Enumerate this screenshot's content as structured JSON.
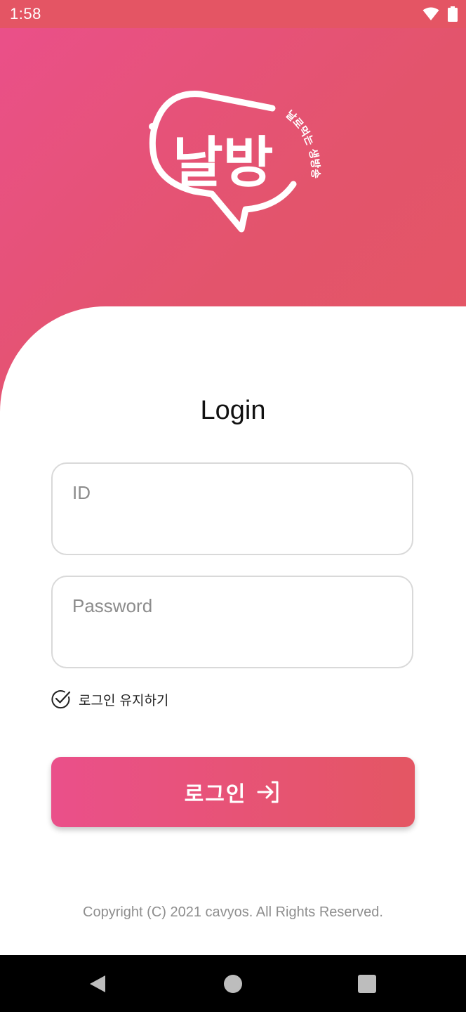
{
  "status_bar": {
    "time": "1:58",
    "icons": [
      "wifi-icon",
      "battery-icon"
    ]
  },
  "logo": {
    "main_text": "날방",
    "tagline": "날로먹는 생방송",
    "color": "#ffffff"
  },
  "login": {
    "title": "Login",
    "id_placeholder": "ID",
    "id_value": "",
    "password_placeholder": "Password",
    "password_value": "",
    "remember_label": "로그인 유지하기",
    "remember_checked": true,
    "button_label": "로그인",
    "button_icon": "login-arrow-icon"
  },
  "footer": {
    "copyright": "Copyright (C) 2021 cavyos. All Rights Reserved."
  },
  "navigation": {
    "buttons": [
      "back-icon",
      "home-icon",
      "recents-icon"
    ]
  },
  "colors": {
    "accent_start": "#ea508a",
    "accent_end": "#e45663",
    "status_bar": "#e45564",
    "field_border": "#d9d9d9"
  }
}
